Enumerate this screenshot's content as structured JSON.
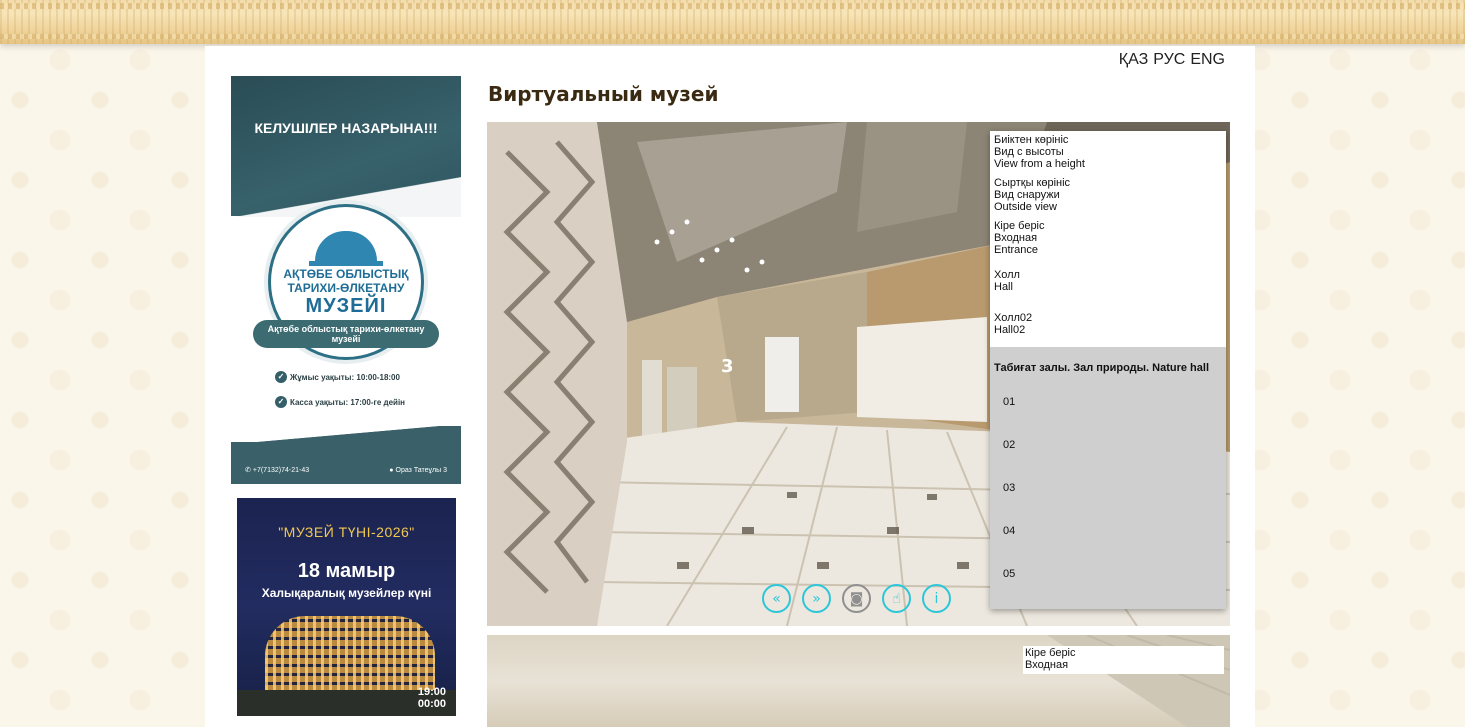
{
  "header": {
    "languages": [
      "ҚАЗ",
      "РУС",
      "ENG"
    ],
    "page_title": "Виртуальный музей"
  },
  "banner_visitors": {
    "heading": "КЕЛУШІЛЕР НАЗАРЫНА!!!",
    "logo_line1": "АҚТӨБЕ ОБЛЫСТЫҚ",
    "logo_line2": "ТАРИХИ-ӨЛКЕТАНУ",
    "logo_line3": "МУЗЕЙІ",
    "museum_name": "Ақтөбе облыстық тарихи-өлкетану музейі",
    "work_hours": "Жұмыс уақыты: 10:00-18:00",
    "cashier_hours": "Касса уақыты: 17:00-ге дейін",
    "phone": "+7(7132)74-21-43",
    "address": "Ораз Татеұлы 3"
  },
  "banner_night": {
    "title": "\"МУЗЕЙ ТҮНІ-2026\"",
    "date": "18 мамыр",
    "subtitle": "Халықаралық музейлер күні",
    "time_start": "19:00",
    "time_end": "00:00"
  },
  "scene_list": {
    "items": [
      {
        "kz": "Биіктен көрініс",
        "ru": "Вид с высоты",
        "en": "View from a height"
      },
      {
        "kz": "Сыртқы көрініс",
        "ru": "Вид снаружи",
        "en": "Outside view"
      },
      {
        "kz": "Кіре беріс",
        "ru": "Входная",
        "en": "Entrance"
      },
      {
        "kz": "Холл",
        "ru": "Hall",
        "en": ""
      },
      {
        "kz": "Холл02",
        "ru": "Hall02",
        "en": ""
      }
    ],
    "hall_title": "Табиғат залы. Зал природы. Nature hall",
    "hall_items": [
      "01",
      "02",
      "03",
      "04",
      "05"
    ]
  },
  "controls": [
    {
      "name": "previous-scene-icon",
      "glyph": "«",
      "gray": false
    },
    {
      "name": "next-scene-icon",
      "glyph": "»",
      "gray": false
    },
    {
      "name": "vr-headset-icon",
      "glyph": "◙",
      "gray": true
    },
    {
      "name": "gyroscope-hand-icon",
      "glyph": "☝",
      "gray": false
    },
    {
      "name": "info-icon",
      "glyph": "i",
      "gray": false
    }
  ],
  "pano2_label": {
    "kz": "Кіре беріс",
    "ru": "Входная"
  },
  "colors": {
    "accent": "#2cc6d9",
    "page_bg": "#fbf6ea",
    "title": "#3a2a12"
  }
}
